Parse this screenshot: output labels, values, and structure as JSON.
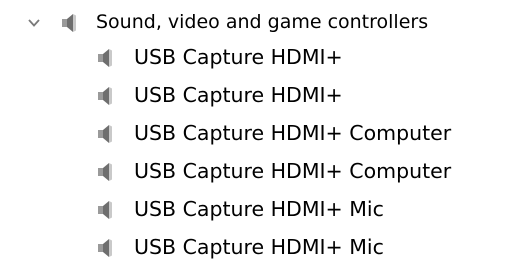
{
  "category": {
    "label": "Sound, video and game controllers",
    "expanded": true,
    "icon": "speaker-icon",
    "chevron_icon": "chevron-down-icon"
  },
  "devices": [
    {
      "label": "USB Capture HDMI+",
      "icon": "speaker-icon"
    },
    {
      "label": "USB Capture HDMI+",
      "icon": "speaker-icon"
    },
    {
      "label": "USB Capture HDMI+ Computer",
      "icon": "speaker-icon"
    },
    {
      "label": "USB Capture HDMI+ Computer",
      "icon": "speaker-icon"
    },
    {
      "label": "USB Capture HDMI+ Mic",
      "icon": "speaker-icon"
    },
    {
      "label": "USB Capture HDMI+ Mic",
      "icon": "speaker-icon"
    }
  ],
  "colors": {
    "chevron": "#7a7a7a",
    "speaker_dark": "#6e6e6e",
    "speaker_mid": "#9a9a9a",
    "speaker_light": "#c9c9c9"
  }
}
